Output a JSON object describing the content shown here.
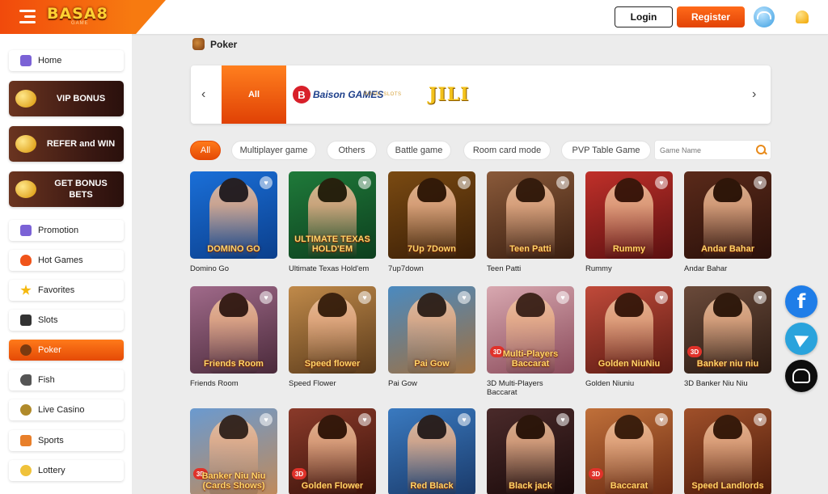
{
  "header": {
    "logo_text": "BASA8",
    "logo_sub": "GAME",
    "login_label": "Login",
    "register_label": "Register"
  },
  "sidebar": {
    "items": [
      {
        "label": "Home",
        "icon": "home-icon",
        "color": "#7b62d6"
      },
      {
        "label": "Promotion",
        "icon": "megaphone-icon",
        "color": "#7b62d6"
      },
      {
        "label": "Hot Games",
        "icon": "fire-icon",
        "color": "#f0541a"
      },
      {
        "label": "Favorites",
        "icon": "star-icon",
        "color": "#f5b90f"
      },
      {
        "label": "Slots",
        "icon": "slot-machine-icon",
        "color": "#333333"
      },
      {
        "label": "Poker",
        "icon": "poker-chip-icon",
        "color": "#ffffff"
      },
      {
        "label": "Fish",
        "icon": "fish-icon",
        "color": "#555555"
      },
      {
        "label": "Live Casino",
        "icon": "roulette-icon",
        "color": "#b08a2a"
      },
      {
        "label": "Sports",
        "icon": "sports-icon",
        "color": "#e87f2a"
      },
      {
        "label": "Lottery",
        "icon": "lottery-icon",
        "color": "#f0c23a"
      }
    ],
    "promos": [
      {
        "label": "VIP BONUS"
      },
      {
        "label": "REFER and WIN"
      },
      {
        "label": "GET BONUS BETS"
      }
    ]
  },
  "page_title": "Poker",
  "providers": {
    "all_label": "All",
    "baison_mark": "B",
    "baison_text": "Baison GAMES",
    "royal_text": "ROYAL SLOTS",
    "jili_text": "JILI"
  },
  "filters": [
    "All",
    "Multiplayer game",
    "Others",
    "Battle game",
    "Room card mode",
    "PVP Table Game"
  ],
  "search": {
    "placeholder": "Game Name"
  },
  "games": [
    {
      "name": "Domino Go",
      "title": "DOMINO GO",
      "bg": [
        "#1a6fd8",
        "#0b3f8c"
      ],
      "d3": false
    },
    {
      "name": "Ultimate Texas Hold'em",
      "title": "ULTIMATE TEXAS HOLD'EM",
      "bg": [
        "#1f7a3a",
        "#0d3f1e"
      ],
      "d3": false
    },
    {
      "name": "7up7down",
      "title": "7Up 7Down",
      "bg": [
        "#7a4a12",
        "#3a1e06"
      ],
      "d3": false
    },
    {
      "name": "Teen Patti",
      "title": "Teen Patti",
      "bg": [
        "#8a5a3a",
        "#3a1e10"
      ],
      "d3": false
    },
    {
      "name": "Rummy",
      "title": "Rummy",
      "bg": [
        "#c0302a",
        "#5a1010"
      ],
      "d3": false
    },
    {
      "name": "Andar Bahar",
      "title": "Andar Bahar",
      "bg": [
        "#5a2a1a",
        "#2a100a"
      ],
      "d3": false
    },
    {
      "name": "Friends Room",
      "title": "Friends Room",
      "bg": [
        "#a06a8a",
        "#4a2a3a"
      ],
      "d3": false
    },
    {
      "name": "Speed Flower",
      "title": "Speed flower",
      "bg": [
        "#c08a4a",
        "#5a3a1a"
      ],
      "d3": false
    },
    {
      "name": "Pai Gow",
      "title": "Pai Gow",
      "bg": [
        "#4a8ac0",
        "#a07040"
      ],
      "d3": false
    },
    {
      "name": "3D Multi-Players Baccarat",
      "title": "Multi-Players Baccarat",
      "bg": [
        "#d8a8b0",
        "#8a4a5a"
      ],
      "d3": true
    },
    {
      "name": "Golden Niuniu",
      "title": "Golden NiuNiu",
      "bg": [
        "#c04a3a",
        "#5a1a12"
      ],
      "d3": false
    },
    {
      "name": "3D Banker Niu Niu",
      "title": "Banker niu niu",
      "bg": [
        "#6a4a3a",
        "#2a1a12"
      ],
      "d3": true
    },
    {
      "name": "",
      "title": "Banker Niu Niu (Cards Shows)",
      "bg": [
        "#6a9ad0",
        "#c08a5a"
      ],
      "d3": true
    },
    {
      "name": "",
      "title": "Golden Flower",
      "bg": [
        "#8a3a2a",
        "#3a120a"
      ],
      "d3": true
    },
    {
      "name": "",
      "title": "Red Black",
      "bg": [
        "#3a7ac0",
        "#1a3a6a"
      ],
      "d3": false
    },
    {
      "name": "",
      "title": "Black jack",
      "bg": [
        "#4a2a2a",
        "#1a0a0a"
      ],
      "d3": false
    },
    {
      "name": "",
      "title": "Baccarat",
      "bg": [
        "#c0703a",
        "#6a2a12"
      ],
      "d3": true
    },
    {
      "name": "",
      "title": "Speed Landlords",
      "bg": [
        "#a0502a",
        "#4a1a0a"
      ],
      "d3": false
    }
  ],
  "social": {
    "facebook_glyph": "f"
  }
}
